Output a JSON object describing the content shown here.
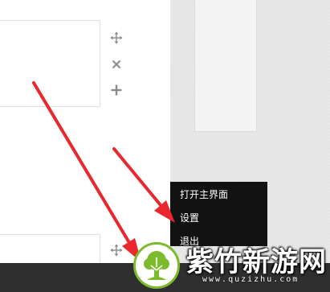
{
  "context_menu": {
    "items": [
      {
        "label": "打开主界面"
      },
      {
        "label": "设置"
      },
      {
        "label": "退出"
      }
    ]
  },
  "panel_tools": {
    "icons": [
      "move-icon",
      "close-icon",
      "add-icon",
      "move-icon"
    ]
  },
  "watermark": {
    "title": "紫竹新游网",
    "url": "www.quzizhu.com"
  },
  "colors": {
    "annotation_arrow": "#e8282e",
    "menu_background": "#121212",
    "taskbar_background": "#2f2f2f",
    "watermark_green": "#7dbb2e"
  }
}
